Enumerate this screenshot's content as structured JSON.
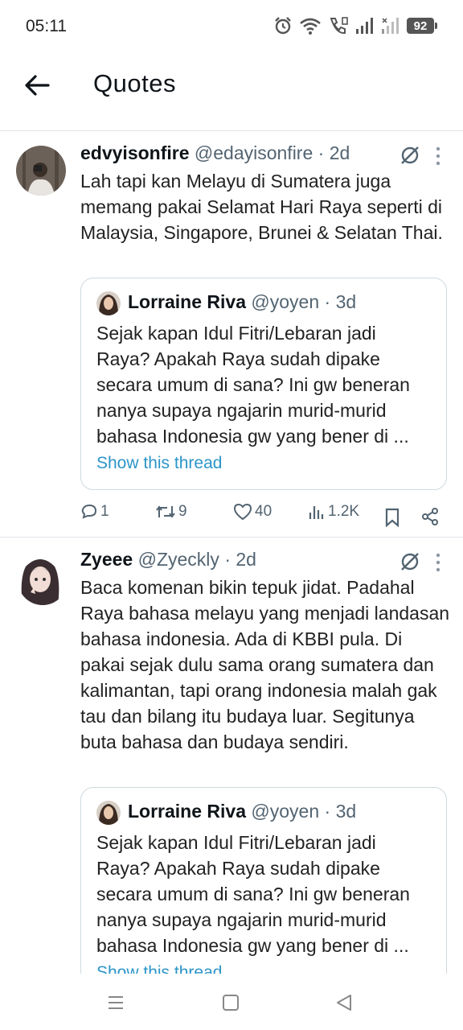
{
  "status_bar": {
    "time": "05:11",
    "battery": "92"
  },
  "header": {
    "title": "Quotes"
  },
  "tweets": [
    {
      "display_name": "edvyisonfire",
      "handle": "@edayisonfire",
      "separator": "·",
      "time": "2d",
      "text": "Lah tapi kan Melayu di Sumatera juga memang pakai Selamat Hari Raya seperti di Malaysia, Singapore, Brunei & Selatan Thai.",
      "quoted": {
        "display_name": "Lorraine Riva",
        "handle": "@yoyen",
        "separator": "·",
        "time": "3d",
        "text": "Sejak kapan Idul Fitri/Lebaran jadi Raya? Apakah Raya sudah dipake secara umum di sana? Ini gw beneran nanya supaya ngajarin murid-murid bahasa Indonesia gw yang bener di ...",
        "link": "Show this thread"
      },
      "actions": {
        "replies": "1",
        "reposts": "9",
        "likes": "40",
        "views": "1.2K"
      }
    },
    {
      "display_name": "Zyeee",
      "handle": "@Zyeckly",
      "separator": "·",
      "time": "2d",
      "text": "Baca komenan bikin tepuk jidat. Padahal Raya bahasa melayu yang menjadi landasan bahasa indonesia. Ada di KBBI pula. Di pakai sejak dulu sama orang sumatera dan kalimantan, tapi orang indonesia malah gak tau dan bilang itu budaya luar. Segitunya buta bahasa dan budaya sendiri.",
      "quoted": {
        "display_name": "Lorraine Riva",
        "handle": "@yoyen",
        "separator": "·",
        "time": "3d",
        "text": "Sejak kapan Idul Fitri/Lebaran jadi Raya? Apakah Raya sudah dipake secara umum di sana? Ini gw beneran nanya supaya ngajarin murid-murid bahasa Indonesia gw yang bener di ...",
        "link": "Show this thread"
      }
    }
  ],
  "colors": {
    "text": "#0f1419",
    "secondary": "#536471",
    "link": "#2c95c8",
    "border": "#cfd9de"
  }
}
